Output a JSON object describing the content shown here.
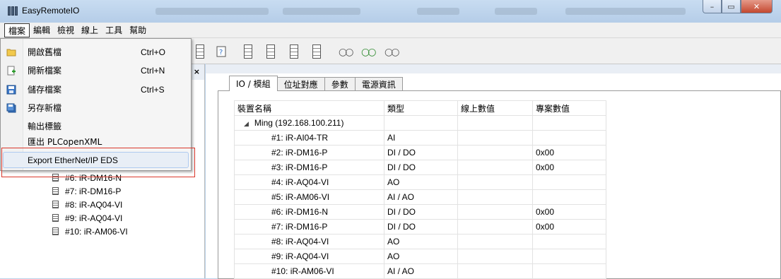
{
  "window": {
    "title": "EasyRemoteIO"
  },
  "menubar": {
    "items": [
      "檔案",
      "編輯",
      "檢視",
      "線上",
      "工具",
      "幫助"
    ]
  },
  "file_menu": {
    "items": [
      {
        "label": "開啟舊檔",
        "shortcut": "Ctrl+O",
        "icon": "folder-icon"
      },
      {
        "label": "開新檔案",
        "shortcut": "Ctrl+N",
        "icon": "new-file-icon"
      },
      {
        "label": "儲存檔案",
        "shortcut": "Ctrl+S",
        "icon": "save-icon"
      },
      {
        "label": "另存新檔",
        "shortcut": "",
        "icon": "save-as-icon"
      },
      {
        "label": "輸出標籤",
        "shortcut": ""
      },
      {
        "label": "匯出 PLCopenXML",
        "shortcut": ""
      },
      {
        "label": "Export EtherNet/IP EDS",
        "shortcut": ""
      }
    ]
  },
  "panel": {
    "controls": "ᗰ ×"
  },
  "tree": {
    "items": [
      "#6: iR-DM16-N",
      "#7: iR-DM16-P",
      "#8: iR-AQ04-VI",
      "#9: iR-AQ04-VI",
      "#10: iR-AM06-VI"
    ]
  },
  "tabs": [
    "IO / 模組",
    "位址對應",
    "參數",
    "電源資訊"
  ],
  "table": {
    "headers": [
      "裝置名稱",
      "類型",
      "線上數值",
      "專案數值"
    ],
    "group": "Ming (192.168.100.211)",
    "rows": [
      {
        "name": "#1: iR-AI04-TR",
        "type": "AI",
        "online": "",
        "project": ""
      },
      {
        "name": "#2: iR-DM16-P",
        "type": "DI / DO",
        "online": "",
        "project": "0x00"
      },
      {
        "name": "#3: iR-DM16-P",
        "type": "DI / DO",
        "online": "",
        "project": "0x00"
      },
      {
        "name": "#4: iR-AQ04-VI",
        "type": "AO",
        "online": "",
        "project": ""
      },
      {
        "name": "#5: iR-AM06-VI",
        "type": "AI / AO",
        "online": "",
        "project": ""
      },
      {
        "name": "#6: iR-DM16-N",
        "type": "DI / DO",
        "online": "",
        "project": "0x00"
      },
      {
        "name": "#7: iR-DM16-P",
        "type": "DI / DO",
        "online": "",
        "project": "0x00"
      },
      {
        "name": "#8: iR-AQ04-VI",
        "type": "AO",
        "online": "",
        "project": ""
      },
      {
        "name": "#9: iR-AQ04-VI",
        "type": "AO",
        "online": "",
        "project": ""
      },
      {
        "name": "#10: iR-AM06-VI",
        "type": "AI / AO",
        "online": "",
        "project": ""
      }
    ]
  },
  "colors": {
    "highlight_border": "#d9372b",
    "titlebar": "#bcd2ea"
  }
}
